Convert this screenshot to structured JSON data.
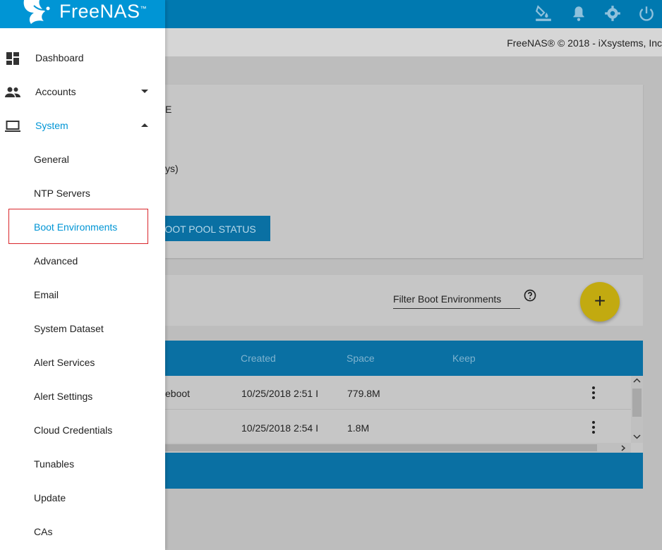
{
  "brand": {
    "name": "FreeNAS",
    "trademark": "™"
  },
  "header": {
    "icons": [
      "theme-icon",
      "bell-icon",
      "gear-icon",
      "power-icon"
    ]
  },
  "subheader": {
    "copyright": "FreeNAS® © 2018 - iXsystems, Inc"
  },
  "background": {
    "card1": {
      "text_fragments": [
        "E",
        "ys)"
      ],
      "button_label": "BOOT POOL STATUS"
    },
    "card2": {
      "filter_placeholder": "Filter Boot Environments",
      "fab_label": "+",
      "columns": [
        "Created",
        "Space",
        "Keep"
      ],
      "rows": [
        {
          "name": "eboot",
          "created": "10/25/2018 2:51 I",
          "space": "779.8M"
        },
        {
          "name": "",
          "created": "10/25/2018 2:54 I",
          "space": "1.8M"
        }
      ]
    }
  },
  "sidebar": {
    "items": [
      {
        "label": "Dashboard",
        "icon": "dashboard-icon"
      },
      {
        "label": "Accounts",
        "icon": "people-icon"
      },
      {
        "label": "System",
        "icon": "laptop-icon"
      }
    ],
    "system_children": [
      "General",
      "NTP Servers",
      "Boot Environments",
      "Advanced",
      "Email",
      "System Dataset",
      "Alert Services",
      "Alert Settings",
      "Cloud Credentials",
      "Tunables",
      "Update",
      "CAs"
    ],
    "selected": "Boot Environments"
  },
  "colors": {
    "accent": "#0095d5",
    "header": "#0079b0",
    "highlight_border": "#d9262b",
    "fab": "#c2aa10"
  }
}
